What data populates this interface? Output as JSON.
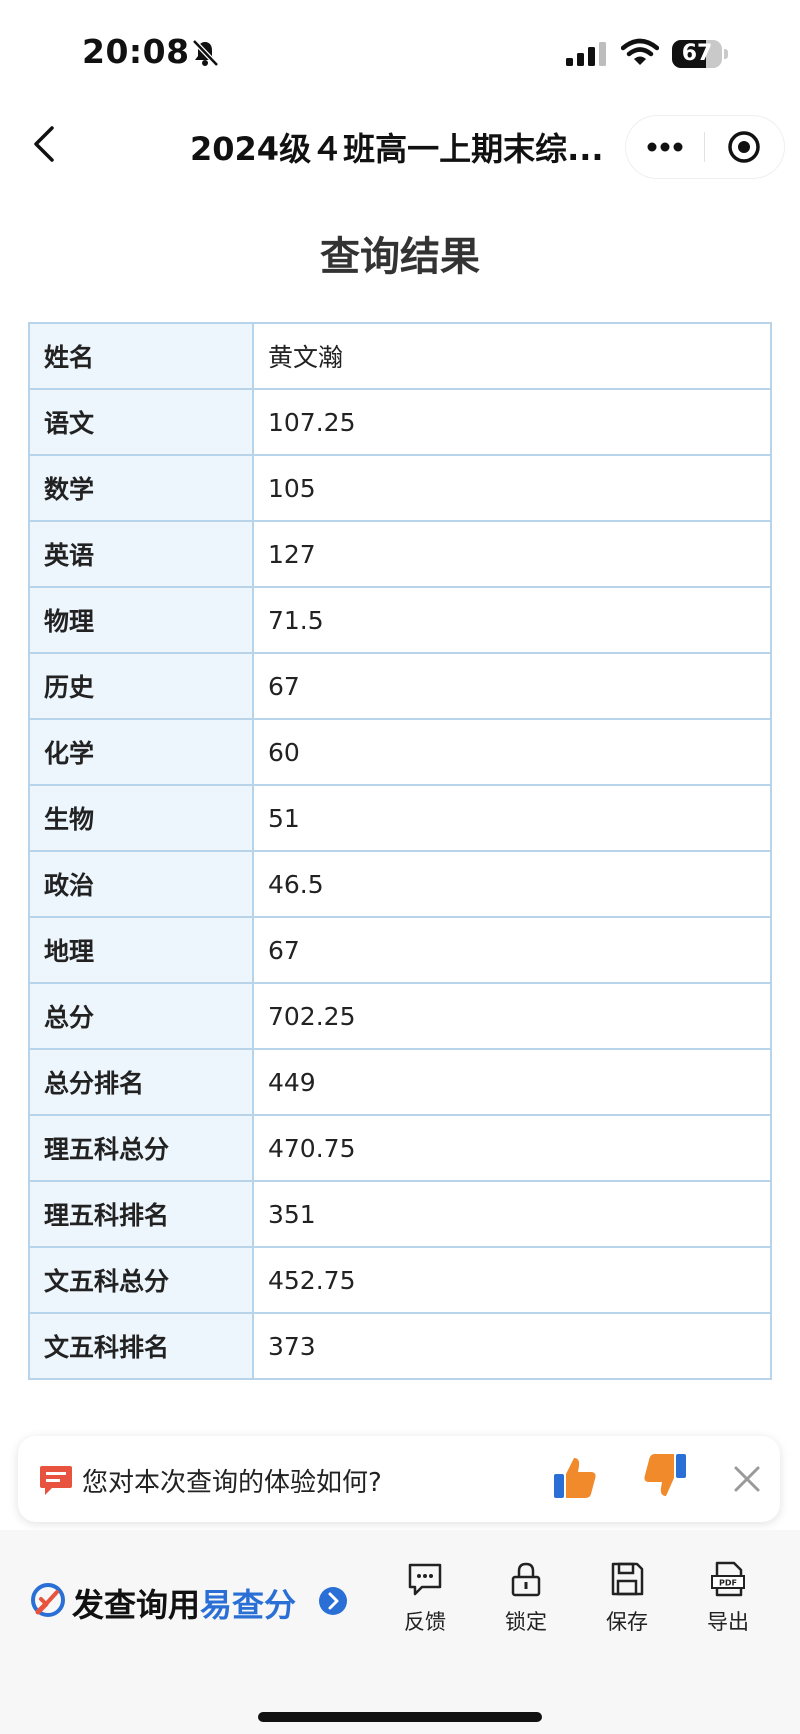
{
  "status_bar": {
    "time": "20:08",
    "battery_text": "67",
    "battery_level": 0.67
  },
  "nav": {
    "title": "2024级４班高一上期末综..."
  },
  "page": {
    "title": "查询结果"
  },
  "results": [
    {
      "label": "姓名",
      "value": "黄文瀚"
    },
    {
      "label": "语文",
      "value": "107.25"
    },
    {
      "label": "数学",
      "value": "105"
    },
    {
      "label": "英语",
      "value": "127"
    },
    {
      "label": "物理",
      "value": "71.5"
    },
    {
      "label": "历史",
      "value": "67"
    },
    {
      "label": "化学",
      "value": "60"
    },
    {
      "label": "生物",
      "value": "51"
    },
    {
      "label": "政治",
      "value": "46.5"
    },
    {
      "label": "地理",
      "value": "67"
    },
    {
      "label": "总分",
      "value": "702.25"
    },
    {
      "label": "总分排名",
      "value": "449"
    },
    {
      "label": "理五科总分",
      "value": "470.75"
    },
    {
      "label": "理五科排名",
      "value": "351"
    },
    {
      "label": "文五科总分",
      "value": "452.75"
    },
    {
      "label": "文五科排名",
      "value": "373"
    }
  ],
  "feedback": {
    "prompt": "您对本次查询的体验如何?"
  },
  "bottom": {
    "brand_prefix": "发查询用",
    "brand_name": "易查分",
    "tools": [
      {
        "label": "反馈",
        "icon": "feedback-icon"
      },
      {
        "label": "锁定",
        "icon": "lock-icon"
      },
      {
        "label": "保存",
        "icon": "save-icon"
      },
      {
        "label": "导出",
        "icon": "pdf-export-icon"
      }
    ]
  },
  "colors": {
    "accent": "#2a6fd6",
    "table_border": "#b7d4ea",
    "label_bg": "#eef6fd",
    "thumbs_up": "#f08a2b",
    "feedback_icon": "#e8533f"
  }
}
